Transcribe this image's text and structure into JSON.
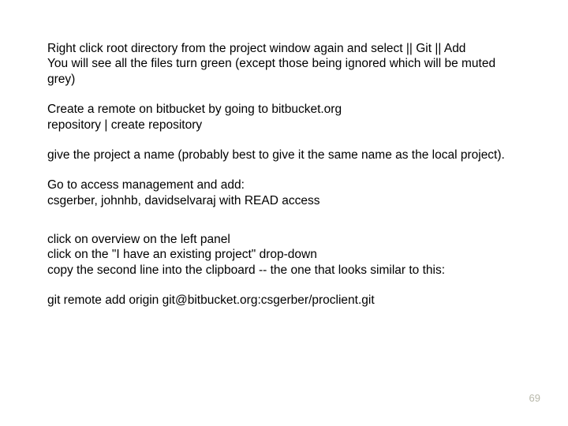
{
  "paragraphs": {
    "p1a": "Right click root directory from the project window again and select || Git || Add",
    "p1b": "You will see all the files turn green (except those being ignored which will be muted grey)",
    "p2a": "Create a remote on bitbucket by going to bitbucket.org",
    "p2b": "repository | create repository",
    "p3": "give the project a name (probably best to give it the same name as the local project).",
    "p4a": "Go to access management and add:",
    "p4b": " csgerber, johnhb, davidselvaraj with READ access",
    "p5a": "click on overview on the left panel",
    "p5b": "click on the \"I have an existing project\" drop-down",
    "p5c": "copy the second line into the clipboard -- the one that looks similar to this:",
    "p6": "git remote add origin git@bitbucket.org:csgerber/proclient.git"
  },
  "page_number": "69"
}
